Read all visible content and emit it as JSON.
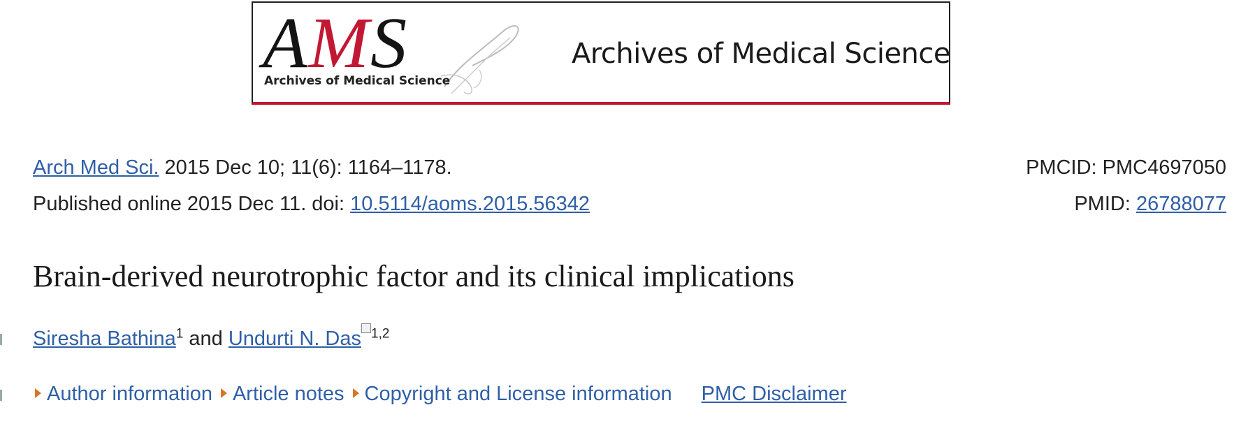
{
  "banner": {
    "logo_letters": [
      "A",
      "M",
      "S"
    ],
    "logo_subtitle": "Archives of Medical Science",
    "journal_name": "Archives of Medical Science"
  },
  "citation": {
    "journal_abbrev": "Arch Med Sci.",
    "date_volume": " 2015 Dec 10; 11(6): 1164–1178.",
    "published_online": "Published online 2015 Dec 11. doi: ",
    "doi": "10.5114/aoms.2015.56342",
    "pmcid_label": "PMCID: PMC4697050",
    "pmid_label": "PMID: ",
    "pmid": "26788077"
  },
  "article": {
    "title": "Brain-derived neurotrophic factor and its clinical implications"
  },
  "authors": {
    "author1_name": "Siresha Bathina",
    "author1_sup": "1",
    "conjunction": " and ",
    "author2_name": "Undurti N. Das",
    "author2_sup": "1,2"
  },
  "notes": {
    "author_information": "Author information",
    "article_notes": "Article notes",
    "copyright": "Copyright and License information",
    "disclaimer": "PMC Disclaimer"
  },
  "colors": {
    "link": "#2f5fa7",
    "brand_red": "#c21834",
    "expand_arrow": "#d8742a"
  }
}
